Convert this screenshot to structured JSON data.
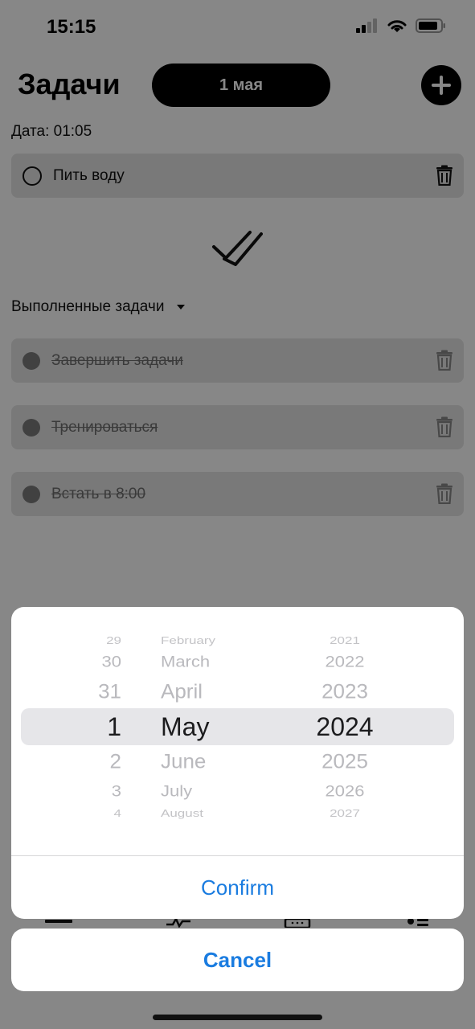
{
  "status_bar": {
    "time": "15:15"
  },
  "header": {
    "title": "Задачи",
    "date_pill": "1 мая",
    "date_label": "Дата: 01:05"
  },
  "active_tasks": [
    {
      "text": "Пить воду"
    }
  ],
  "completed_section": {
    "label": "Выполненные задачи",
    "tasks": [
      {
        "text": "Завершить задачи"
      },
      {
        "text": "Тренироваться"
      },
      {
        "text": "Встать в 8:00"
      }
    ]
  },
  "picker": {
    "days": [
      "29",
      "30",
      "31",
      "1",
      "2",
      "3",
      "4"
    ],
    "months": [
      "February",
      "March",
      "April",
      "May",
      "June",
      "July",
      "August"
    ],
    "years": [
      "2021",
      "2022",
      "2023",
      "2024",
      "2025",
      "2026",
      "2027"
    ],
    "selected": {
      "day": "1",
      "month": "May",
      "year": "2024"
    }
  },
  "actions": {
    "confirm_label": "Confirm",
    "cancel_label": "Cancel"
  },
  "colors": {
    "accent": "#1a7ce0",
    "pill_bg": "#000000",
    "overlay": "rgba(0,0,0,0.47)"
  },
  "icons": {
    "add": "plus-icon",
    "trash": "trash-icon",
    "completed": "double-check-icon",
    "caret": "caret-down-icon"
  }
}
